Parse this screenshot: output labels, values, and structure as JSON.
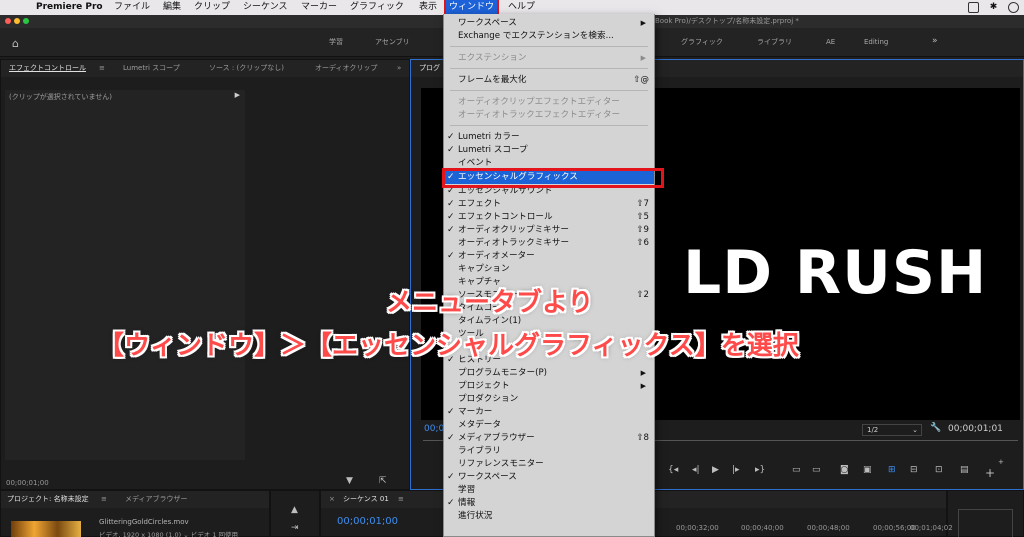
{
  "menubar": {
    "apple": "",
    "app_name": "Premiere Pro",
    "items": [
      "ファイル",
      "編集",
      "クリップ",
      "シーケンス",
      "マーカー",
      "グラフィック",
      "表示",
      "ウィンドウ",
      "ヘルプ"
    ]
  },
  "title_fragment": "Book Pro)/デスクトップ/名称未設定.prproj *",
  "workspaces": [
    "学習",
    "アセンブリ",
    "グラフィック",
    "ライブラリ",
    "AE",
    "Editing"
  ],
  "left_panel": {
    "tabs": [
      "エフェクトコントロール",
      "Lumetri スコープ",
      "ソース : (クリップなし)",
      "オーディオクリップ"
    ],
    "no_clip": "(クリップが選択されていません)",
    "timecode": "00;00;01;00"
  },
  "program": {
    "tab": "プログ",
    "video_text": "LD RUSH",
    "timecode_left": "00;0",
    "resolution": "1/2",
    "timecode_right": "00;00;01;01"
  },
  "bottom": {
    "project_tab": "プロジェクト: 名称未設定",
    "media_tab": "メディアブラウザー",
    "clip_name": "GlitteringGoldCircles.mov",
    "clip_info": "ビデオ, 1920 x 1080 (1.0) ⌄ ビデオ 1 回使用",
    "sequence_tab": "シーケンス 01",
    "sequence_tc": "00;00;01;00",
    "ruler": [
      "00;00;32;00",
      "00;00;40;00",
      "00;00;48;00",
      "00;00;56;00",
      "00;01;04;02"
    ]
  },
  "window_menu": {
    "items": [
      {
        "label": "ワークスペース",
        "arrow": "▶"
      },
      {
        "label": "Exchange でエクステンションを検索..."
      },
      {
        "label": "エクステンション",
        "arrow": "▶",
        "dim": true
      },
      {
        "label": "フレームを最大化",
        "shortcut": "⇧@"
      },
      {
        "label": "オーディオクリップエフェクトエディター",
        "dim": true
      },
      {
        "label": "オーディオトラックエフェクトエディター",
        "dim": true
      },
      {
        "label": "Lumetri カラー",
        "check": "✓"
      },
      {
        "label": "Lumetri スコープ",
        "check": "✓"
      },
      {
        "label": "イベント"
      },
      {
        "label": "エッセンシャルグラフィックス",
        "check": "✓",
        "highlight": true
      },
      {
        "label": "エッセンシャルサウンド",
        "check": "✓"
      },
      {
        "label": "エフェクト",
        "check": "✓",
        "shortcut": "⇧7"
      },
      {
        "label": "エフェクトコントロール",
        "check": "✓",
        "shortcut": "⇧5"
      },
      {
        "label": "オーディオクリップミキサー",
        "check": "✓",
        "shortcut": "⇧9"
      },
      {
        "label": "オーディオトラックミキサー",
        "shortcut": "⇧6"
      },
      {
        "label": "オーディオメーター",
        "check": "✓"
      },
      {
        "label": "キャプション"
      },
      {
        "label": "キャプチャ"
      },
      {
        "label": "ソースモニター",
        "shortcut": "⇧2"
      },
      {
        "label": "タイムコード"
      },
      {
        "label": "タイムライン(1)"
      },
      {
        "label": "ツール"
      },
      {
        "label": "ヒストリー",
        "check": "✓"
      },
      {
        "label": "プログラムモニター(P)",
        "arrow": "▶"
      },
      {
        "label": "プロジェクト",
        "arrow": "▶"
      },
      {
        "label": "プロダクション"
      },
      {
        "label": "マーカー",
        "check": "✓"
      },
      {
        "label": "メタデータ"
      },
      {
        "label": "メディアブラウザー",
        "check": "✓",
        "shortcut": "⇧8"
      },
      {
        "label": "ライブラリ"
      },
      {
        "label": "リファレンスモニター"
      },
      {
        "label": "ワークスペース",
        "check": "✓"
      },
      {
        "label": "学習"
      },
      {
        "label": "情報",
        "check": "✓"
      },
      {
        "label": "進行状況"
      }
    ]
  },
  "captions": {
    "line1": "メニュータブより",
    "line2": "【ウィンドウ】＞【エッセンシャルグラフィックス】を選択"
  },
  "colors": {
    "accent": "#1c64d6",
    "highlight_box": "#e3141b",
    "caption": "#ff4a4a"
  }
}
